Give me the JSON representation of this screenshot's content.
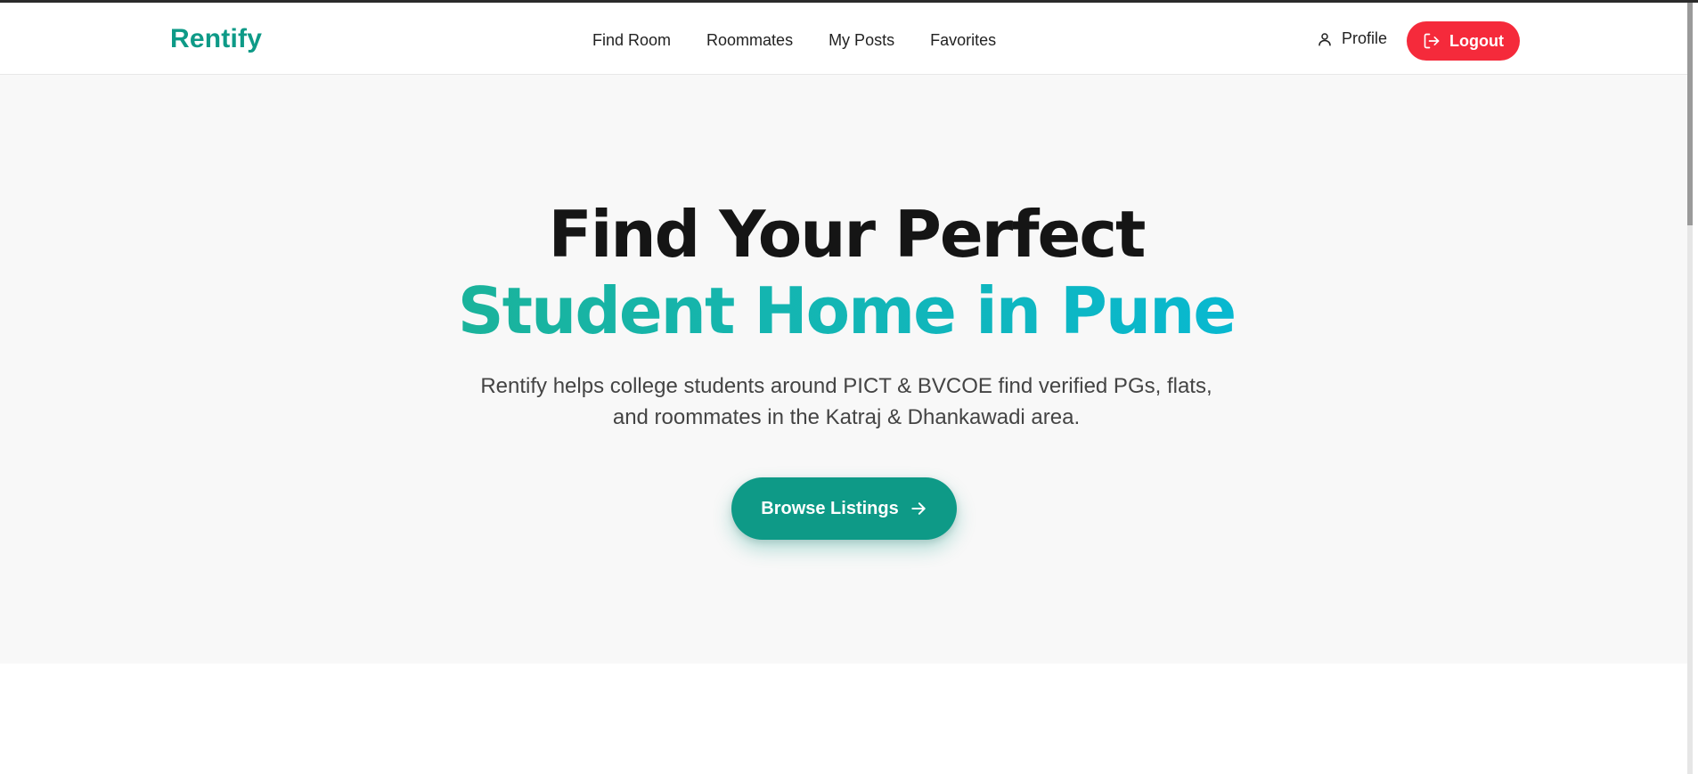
{
  "navbar": {
    "brand": "Rentify",
    "links": [
      {
        "label": "Find Room"
      },
      {
        "label": "Roommates"
      },
      {
        "label": "My Posts"
      },
      {
        "label": "Favorites"
      }
    ],
    "profile_label": "Profile",
    "logout_label": "Logout"
  },
  "hero": {
    "title_line1": "Find Your Perfect",
    "title_line2": "Student Home in Pune",
    "description_line1": "Rentify helps college students around PICT & BVCOE find verified PGs, flats,",
    "description_line2": "and roommates in the Katraj & Dhankawadi area.",
    "cta_label": "Browse Listings"
  },
  "colors": {
    "brand": "#0e9a87",
    "logout": "#f52a3b",
    "hero_bg": "#f8f8f8",
    "gradient_start": "#1ab39b",
    "gradient_end": "#08b8d0"
  },
  "icons": {
    "profile": "user-icon",
    "logout": "logout-icon",
    "cta": "arrow-right-icon"
  }
}
